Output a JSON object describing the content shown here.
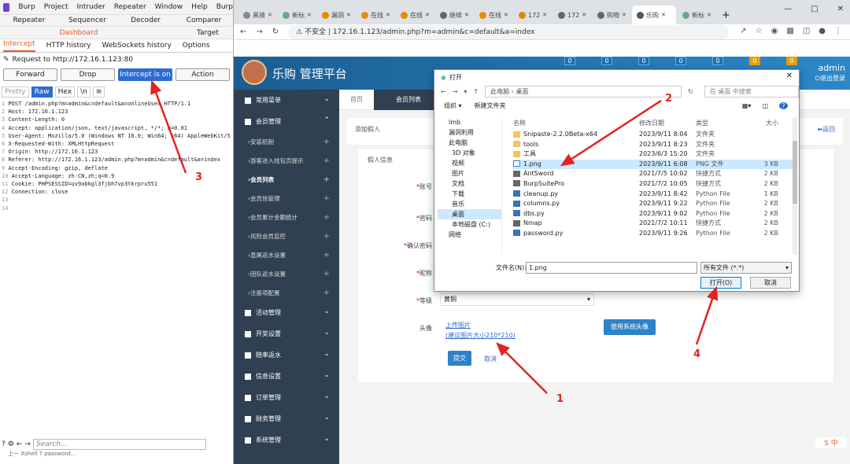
{
  "burp": {
    "menu": [
      "Burp",
      "Project",
      "Intruder",
      "Repeater",
      "Window",
      "Help",
      "Burp"
    ],
    "tabs1": [
      "Repeater",
      "Sequencer",
      "Decoder",
      "Comparer"
    ],
    "tabs2": [
      "Dashboard",
      "Target"
    ],
    "subtabs": [
      "Intercept",
      "HTTP history",
      "WebSockets history",
      "Options"
    ],
    "request_line": "Request to http://172.16.1.123:80",
    "actions": {
      "forward": "Forward",
      "drop": "Drop",
      "intercept": "Intercept is on",
      "action": "Action"
    },
    "view": [
      "Pretty",
      "Raw",
      "Hex",
      "\\n"
    ],
    "lines": [
      "POST /admin.php?m=admin&c=default&a=onlineUser HTTP/1.1",
      "Host: 172.16.1.123",
      "Content-Length: 0",
      "Accept: application/json, text/javascript, */*; q=0.01",
      "User-Agent: Mozilla/5.0 (Windows NT 10.0; Win64; x64) AppleWebKit/5",
      "X-Requested-With: XMLHttpRequest",
      "Origin: http://172.16.1.123",
      "Referer: http://172.16.1.123/admin.php?m=admin&c=default&a=index",
      "Accept-Encoding: gzip, deflate",
      "Accept-Language: zh-CN,zh;q=0.9",
      "Cookie: PHPSESSID=uv9abkgl3fjbh7vp3tkrpru551",
      "Connection: close",
      "",
      ""
    ],
    "search_placeholder": "Search...",
    "taskbar": "上一   Xshell 7    password..."
  },
  "browser": {
    "tabs": [
      "黑骑",
      "新标",
      "漏洞",
      "在线",
      "在线",
      "继续",
      "在线",
      "172",
      "172",
      "购物",
      "乐购",
      "新标"
    ],
    "url_warning": "不安全",
    "url": "172.16.1.123/admin.php?m=admin&c=default&a=index",
    "new_tab": "+"
  },
  "admin": {
    "title": "乐购 管理平台",
    "badges": [
      "0",
      "0",
      "0",
      "0",
      "0",
      "0",
      "0"
    ],
    "user": "admin",
    "logout": "退出登录",
    "sidebar": [
      {
        "label": "常用菜单",
        "type": "grp"
      },
      {
        "label": "会员管理",
        "type": "grp"
      },
      {
        "label": "安装机制",
        "type": "sub"
      },
      {
        "label": "游客进入线包页提示",
        "type": "sub"
      },
      {
        "label": "会员列表",
        "type": "sub",
        "active": true
      },
      {
        "label": "会员信管理",
        "type": "sub"
      },
      {
        "label": "会员累计金额统计",
        "type": "sub"
      },
      {
        "label": "风险会员监控",
        "type": "sub"
      },
      {
        "label": "直属返水设置",
        "type": "sub"
      },
      {
        "label": "团队返水设置",
        "type": "sub"
      },
      {
        "label": "注册项配置",
        "type": "sub"
      },
      {
        "label": "活动管理",
        "type": "grp"
      },
      {
        "label": "开奖设置",
        "type": "grp"
      },
      {
        "label": "赔率返水",
        "type": "grp"
      },
      {
        "label": "信息设置",
        "type": "grp"
      },
      {
        "label": "订单管理",
        "type": "grp"
      },
      {
        "label": "财务管理",
        "type": "grp"
      },
      {
        "label": "系统管理",
        "type": "grp"
      }
    ],
    "ctabs": [
      "首页",
      "会员列表"
    ],
    "panel_title": "添加假人",
    "back": "返回",
    "form_title": "假人信息",
    "fields": {
      "account": "账号",
      "password": "密码",
      "confirm": "确认密码",
      "nickname": "昵称",
      "level": "等级",
      "avatar": "头像"
    },
    "level_value": "黄铜",
    "upload": "上传图片",
    "upload_hint": "(建议图片大小210*210)",
    "use_system": "使用系统头像",
    "submit": "提交",
    "cancel": "取消"
  },
  "dialog": {
    "title": "打开",
    "breadcrumb": "此电脑  ›  桌面",
    "search_placeholder": "在 桌面 中搜索",
    "organize": "组织 ▾",
    "new_folder": "新建文件夹",
    "tree": [
      "lmb",
      "漏洞利用",
      "此电脑",
      "3D 对象",
      "视频",
      "图片",
      "文档",
      "下载",
      "音乐",
      "桌面",
      "本地磁盘 (C:)",
      "网络"
    ],
    "headers": [
      "名称",
      "修改日期",
      "类型",
      "大小"
    ],
    "files": [
      {
        "name": "Snipaste-2.2.0Beta-x64",
        "date": "2023/9/11 8:04",
        "type": "文件夹",
        "size": "",
        "icon": "folder"
      },
      {
        "name": "tools",
        "date": "2023/9/11 8:23",
        "type": "文件夹",
        "size": "",
        "icon": "folder"
      },
      {
        "name": "工具",
        "date": "2023/6/3 15:20",
        "type": "文件夹",
        "size": "",
        "icon": "folder"
      },
      {
        "name": "1.png",
        "date": "2023/9/11 6:08",
        "type": "PNG 文件",
        "size": "3 KB",
        "icon": "doc",
        "sel": true
      },
      {
        "name": "AntSword",
        "date": "2021/7/5 10:02",
        "type": "快捷方式",
        "size": "2 KB",
        "icon": "sc"
      },
      {
        "name": "BurpSuitePro",
        "date": "2021/7/2 10:05",
        "type": "快捷方式",
        "size": "2 KB",
        "icon": "sc"
      },
      {
        "name": "cleanup.py",
        "date": "2023/9/11 8:42",
        "type": "Python File",
        "size": "1 KB",
        "icon": "py"
      },
      {
        "name": "columns.py",
        "date": "2023/9/11 9:22",
        "type": "Python File",
        "size": "2 KB",
        "icon": "py"
      },
      {
        "name": "dbs.py",
        "date": "2023/9/11 9:02",
        "type": "Python File",
        "size": "2 KB",
        "icon": "py"
      },
      {
        "name": "Nmap",
        "date": "2021/7/2 10:11",
        "type": "快捷方式",
        "size": "2 KB",
        "icon": "sc"
      },
      {
        "name": "password.py",
        "date": "2023/9/11 9:26",
        "type": "Python File",
        "size": "2 KB",
        "icon": "py"
      }
    ],
    "filename_label": "文件名(N):",
    "filename": "1.png",
    "filetype": "所有文件 (*.*)",
    "open": "打开(O)",
    "cancel": "取消"
  },
  "annotations": [
    "1",
    "2",
    "3",
    "4"
  ],
  "colors": {
    "annotation": "#e32222",
    "burp_accent": "#e35c26",
    "header": "#2d88c8",
    "sidebar": "#2f4050"
  }
}
